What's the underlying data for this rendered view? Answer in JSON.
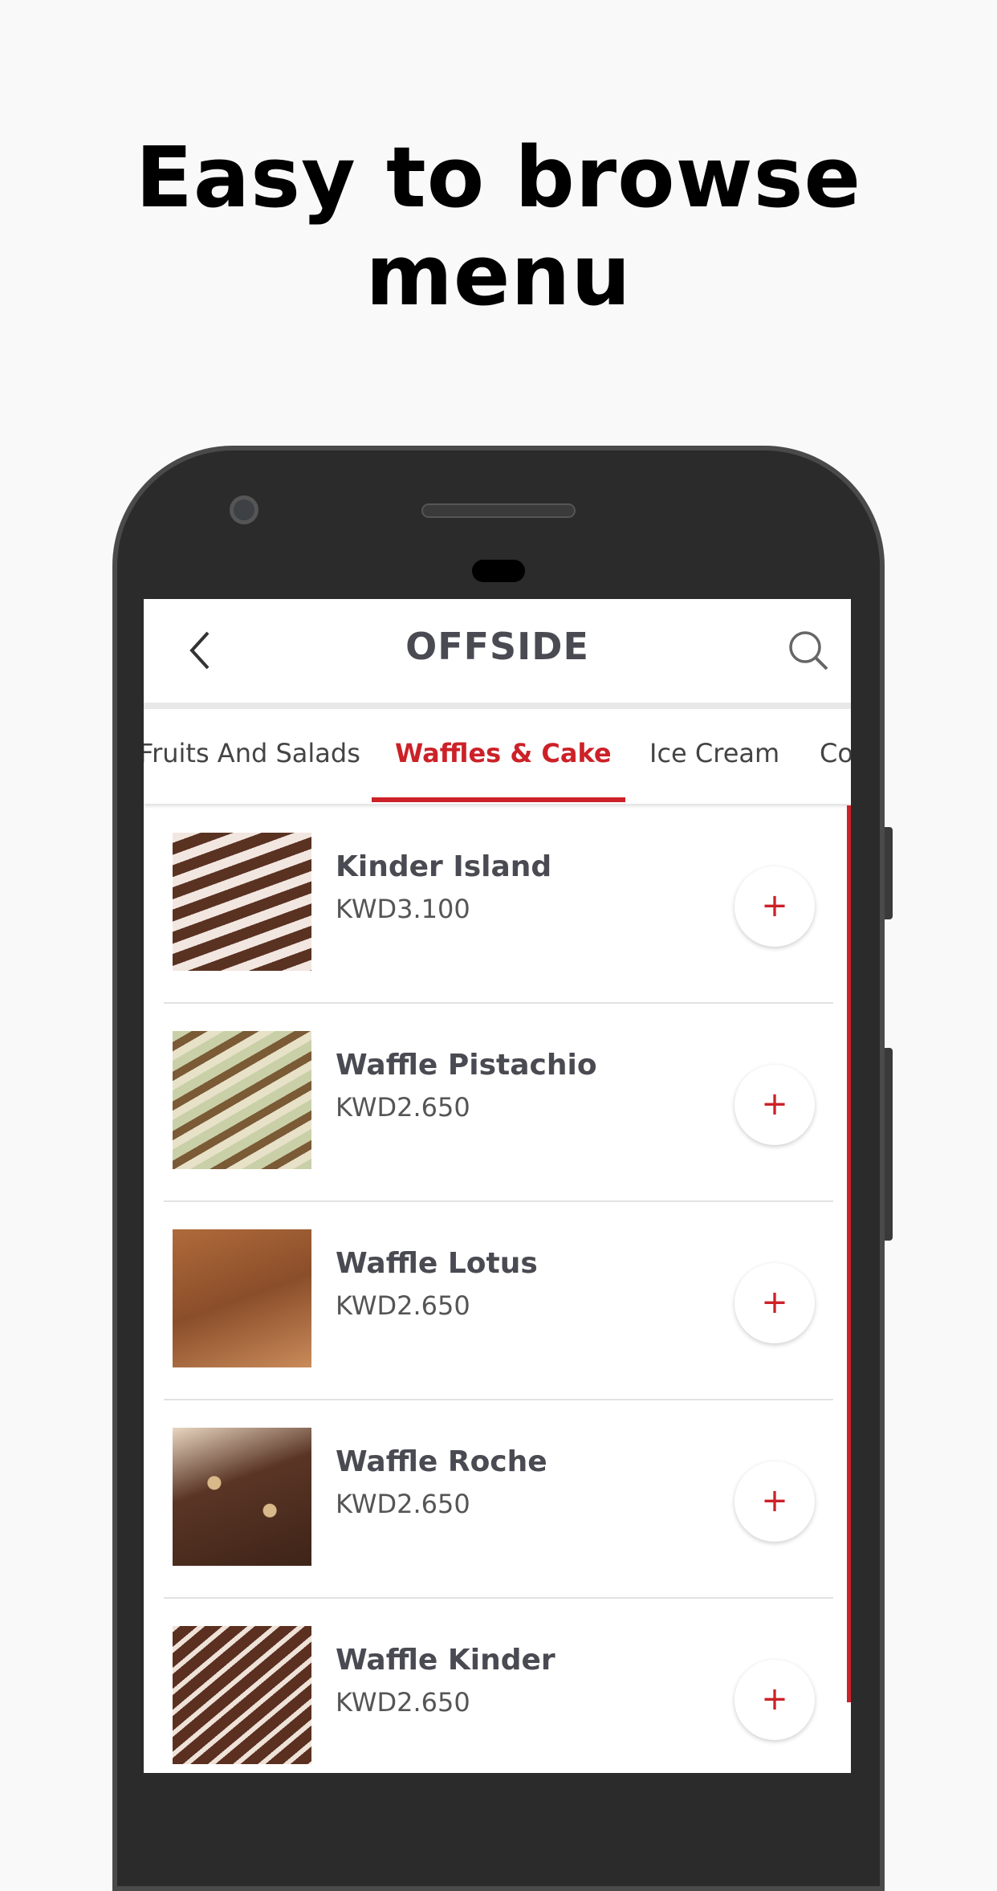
{
  "headline": "Easy to browse menu",
  "header": {
    "title": "OFFSIDE",
    "back_icon": "chevron-left-icon",
    "search_icon": "search-icon"
  },
  "tabs": [
    {
      "label": "Fruits And Salads",
      "active": false
    },
    {
      "label": "Waffles & Cake",
      "active": true
    },
    {
      "label": "Ice Cream",
      "active": false
    },
    {
      "label": "Co",
      "active": false
    }
  ],
  "colors": {
    "accent": "#cc2128",
    "text": "#4a4a52"
  },
  "items": [
    {
      "name": "Kinder Island",
      "price": "KWD3.100",
      "add_label": "+"
    },
    {
      "name": "Waffle Pistachio",
      "price": "KWD2.650",
      "add_label": "+"
    },
    {
      "name": "Waffle Lotus",
      "price": "KWD2.650",
      "add_label": "+"
    },
    {
      "name": "Waffle Roche",
      "price": "KWD2.650",
      "add_label": "+"
    },
    {
      "name": "Waffle Kinder",
      "price": "KWD2.650",
      "add_label": "+"
    }
  ]
}
